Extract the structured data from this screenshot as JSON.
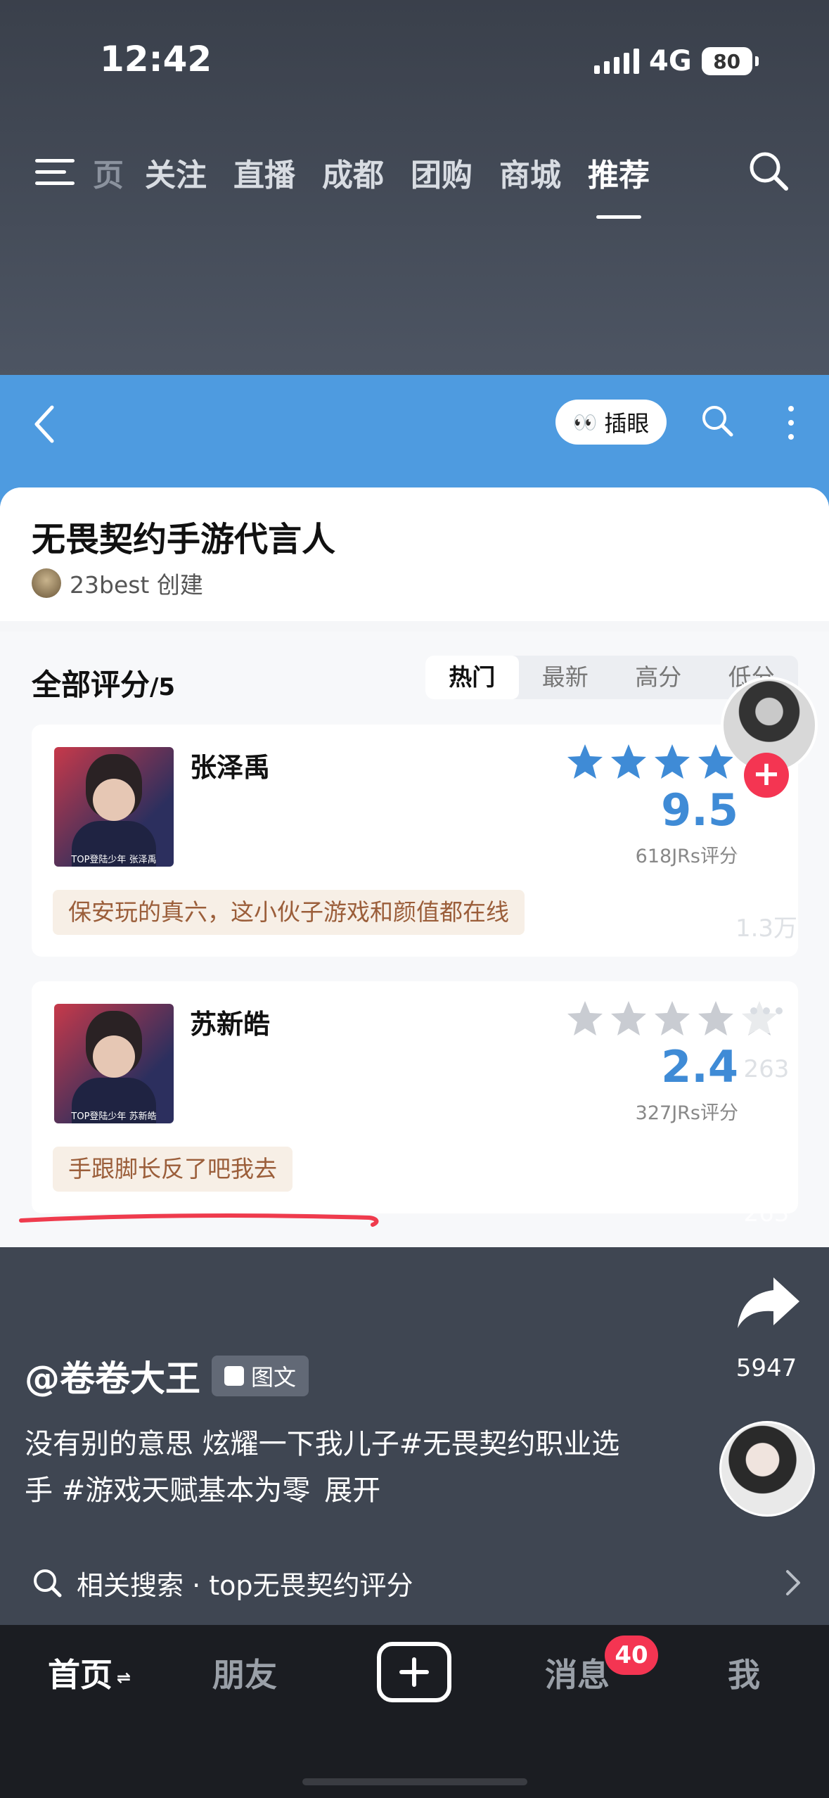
{
  "status_bar": {
    "time": "12:42",
    "network": "4G",
    "battery": "80"
  },
  "top_nav": {
    "tabs": [
      "页",
      "关注",
      "直播",
      "成都",
      "团购",
      "商城",
      "推荐"
    ],
    "active": "推荐"
  },
  "embedded": {
    "peek_button": "插眼",
    "title": "无畏契约手游代言人",
    "creator": "23best 创建",
    "section_title": "全部评分",
    "section_suffix": "/5",
    "sort_tabs": [
      "热门",
      "最新",
      "高分",
      "低分"
    ],
    "items": [
      {
        "name": "张泽禹",
        "score": "9.5",
        "stars": 5,
        "votes": "618JRs评分",
        "comment": "保安玩的真六，这小伙子游戏和颜值都在线",
        "photo_caption": "TOP登陆少年 张泽禹"
      },
      {
        "name": "苏新皓",
        "score": "2.4",
        "stars": 0,
        "votes": "327JRs评分",
        "comment": "手跟脚长反了吧我去",
        "photo_caption": "TOP登陆少年 苏新皓"
      }
    ]
  },
  "side_actions": {
    "like_count": "1.3万",
    "comment_count": "263",
    "favorite_count": "263",
    "share_count": "5947"
  },
  "post": {
    "author": "@卷卷大王",
    "badge": "图文",
    "description": "没有别的意思 炫耀一下我儿子#无畏契约职业选手 #游戏天赋基本为零",
    "expand": "展开",
    "related_search": "相关搜索 · top无畏契约评分"
  },
  "tab_bar": {
    "home": "首页",
    "friends": "朋友",
    "messages": "消息",
    "messages_badge": "40",
    "me": "我"
  },
  "colors": {
    "accent_blue": "#3f8bd6",
    "header_blue": "#4e9be0",
    "red": "#f43552",
    "comment_text": "#9b5e3a"
  }
}
